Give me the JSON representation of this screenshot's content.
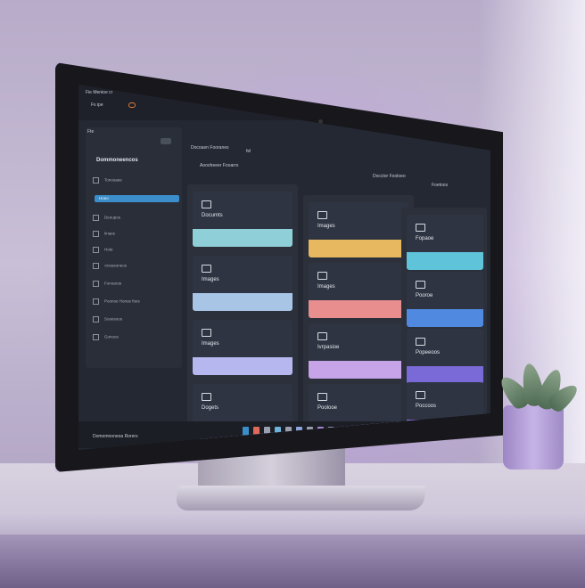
{
  "scene": {
    "description_colors": {
      "accent": "#3b8ec9",
      "glow": "#b88ae6"
    }
  },
  "app": {
    "title": "Fie Menioe cr",
    "tab": "Fs ipe",
    "home_label": "Fte"
  },
  "sidebar": {
    "header": "Dommoneencos",
    "items": [
      {
        "label": "Tonooaee"
      },
      {
        "label": "Hoeo"
      },
      {
        "label": "Deoupos"
      },
      {
        "label": "Iinaes"
      },
      {
        "label": "Hote"
      },
      {
        "label": "Anoasoneos"
      },
      {
        "label": "Fonoaroe"
      },
      {
        "label": "Poonoe Honoe foes"
      },
      {
        "label": "Sooesoos"
      },
      {
        "label": "Gonoos"
      }
    ]
  },
  "toolbar": {
    "breadcrumb": "Docoaen Fooranes",
    "path": "fel",
    "sub": "Aoooheeer Fooarro",
    "mid_label": "Docctor Fooloeo",
    "right_label": "Foetoos"
  },
  "panes": [
    {
      "folders": [
        {
          "name": "Documts",
          "color": "#8fd0d8"
        },
        {
          "name": "Images",
          "color": "#a9c5e6"
        },
        {
          "name": "Images",
          "color": "#b7b7f0"
        },
        {
          "name": "Dogets",
          "color": "#b9b0e8"
        }
      ]
    },
    {
      "folders": [
        {
          "name": "Images",
          "color": "#e8b860"
        },
        {
          "name": "Images",
          "color": "#e88e8e"
        },
        {
          "name": "Ivrpasioe",
          "color": "#c7a3e8"
        },
        {
          "name": "Poolooe",
          "color": "#b0a6ea"
        }
      ]
    },
    {
      "folders": [
        {
          "name": "Fopaoe",
          "color": "#5fc3d9"
        },
        {
          "name": "Pooroe",
          "color": "#4f8ae0"
        },
        {
          "name": "Popeeoos",
          "color": "#7a6ad8"
        },
        {
          "name": "Poccoos",
          "color": "#8a6ad8"
        }
      ]
    }
  ],
  "taskbar": {
    "brand": "Domomnoneoa Rorers"
  }
}
